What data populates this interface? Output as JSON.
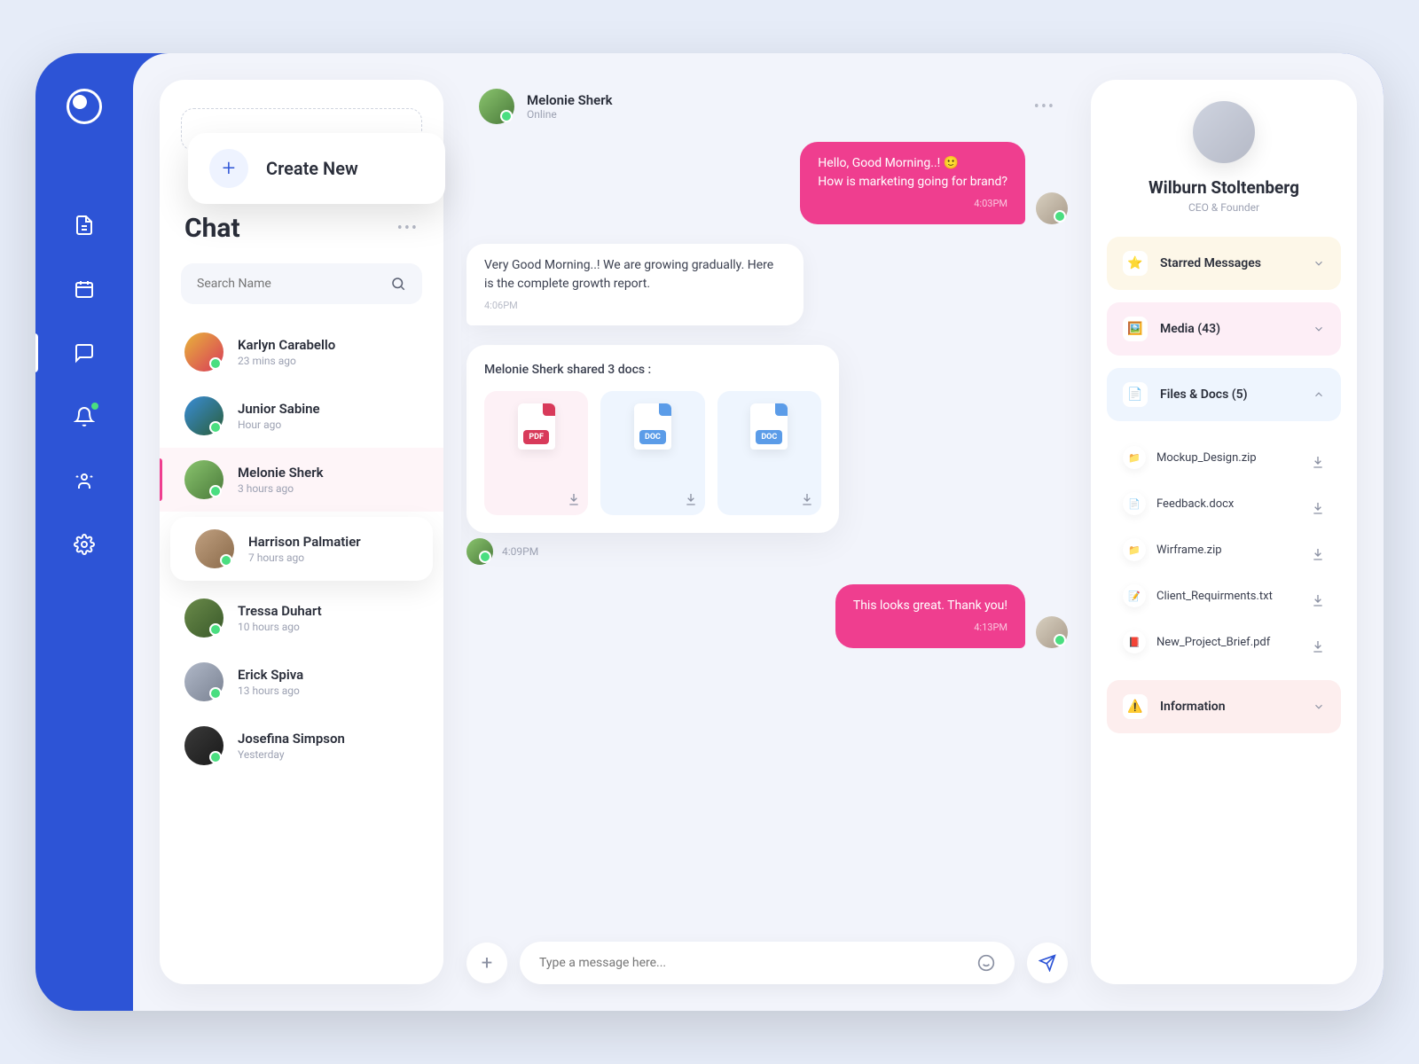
{
  "sidebar": {
    "create_label": "Create New",
    "title": "Chat",
    "search_placeholder": "Search Name"
  },
  "contacts": [
    {
      "name": "Karlyn Carabello",
      "time": "23 mins ago"
    },
    {
      "name": "Junior Sabine",
      "time": "Hour ago"
    },
    {
      "name": "Melonie Sherk",
      "time": "3 hours ago"
    },
    {
      "name": "Harrison Palmatier",
      "time": "7 hours ago"
    },
    {
      "name": "Tressa Duhart",
      "time": "10 hours ago"
    },
    {
      "name": "Erick Spiva",
      "time": "13 hours ago"
    },
    {
      "name": "Josefina Simpson",
      "time": "Yesterday"
    }
  ],
  "chat": {
    "name": "Melonie Sherk",
    "status": "Online",
    "msg1_line1": "Hello, Good Morning..! 🙂",
    "msg1_line2": "How is marketing going for brand?",
    "msg1_time": "4:03PM",
    "msg2": "Very Good Morning..! We are growing gradually. Here is the complete growth report.",
    "msg2_time": "4:06PM",
    "docs_title": "Melonie Sherk shared 3 docs :",
    "docs_time": "4:09PM",
    "doc_labels": [
      "PDF",
      "DOC",
      "DOC"
    ],
    "msg3": "This looks great. Thank you!",
    "msg3_time": "4:13PM",
    "placeholder": "Type a message here..."
  },
  "profile": {
    "name": "Wilburn Stoltenberg",
    "role": "CEO & Founder"
  },
  "sections": {
    "starred": "Starred Messages",
    "media": "Media (43)",
    "files": "Files & Docs (5)",
    "info": "Information"
  },
  "files": [
    {
      "name": "Mockup_Design.zip",
      "emoji": "📁"
    },
    {
      "name": "Feedback.docx",
      "emoji": "📄"
    },
    {
      "name": "Wirframe.zip",
      "emoji": "📁"
    },
    {
      "name": "Client_Requirments.txt",
      "emoji": "📝"
    },
    {
      "name": "New_Project_Brief.pdf",
      "emoji": "📕"
    }
  ]
}
